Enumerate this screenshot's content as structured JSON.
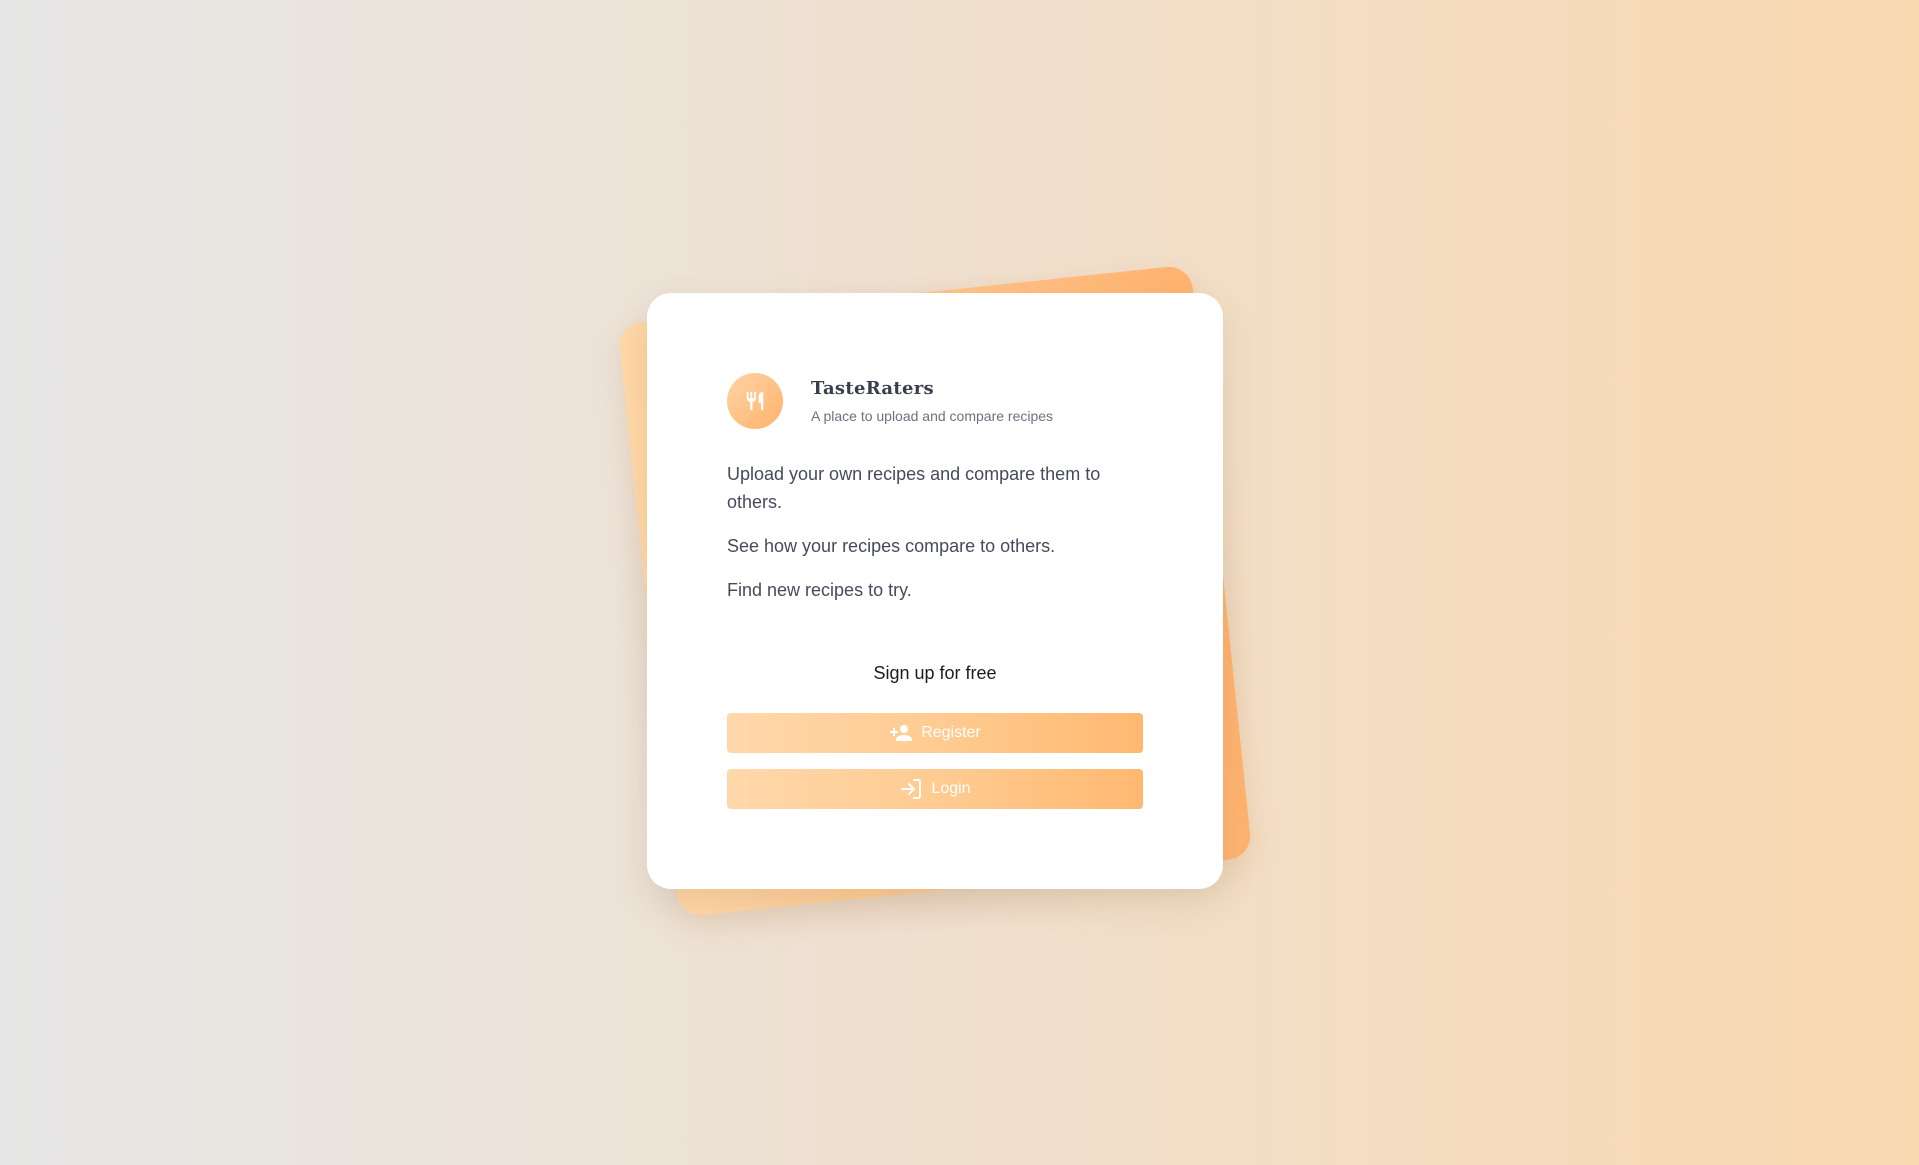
{
  "brand": {
    "name": "TasteRaters",
    "tagline": "A place to upload and compare recipes",
    "logo_icon": "fork-knife-icon"
  },
  "description": [
    "Upload your own recipes and compare them to others.",
    "See how your recipes compare to others.",
    "Find new recipes to try."
  ],
  "signup": {
    "heading": "Sign up for free",
    "register_label": "Register",
    "register_icon": "person-add-icon",
    "login_label": "Login",
    "login_icon": "login-icon"
  },
  "colors": {
    "accent_light": "#ffd8ab",
    "accent_dark": "#ffb36f",
    "text_dark": "#3a3f4f"
  }
}
